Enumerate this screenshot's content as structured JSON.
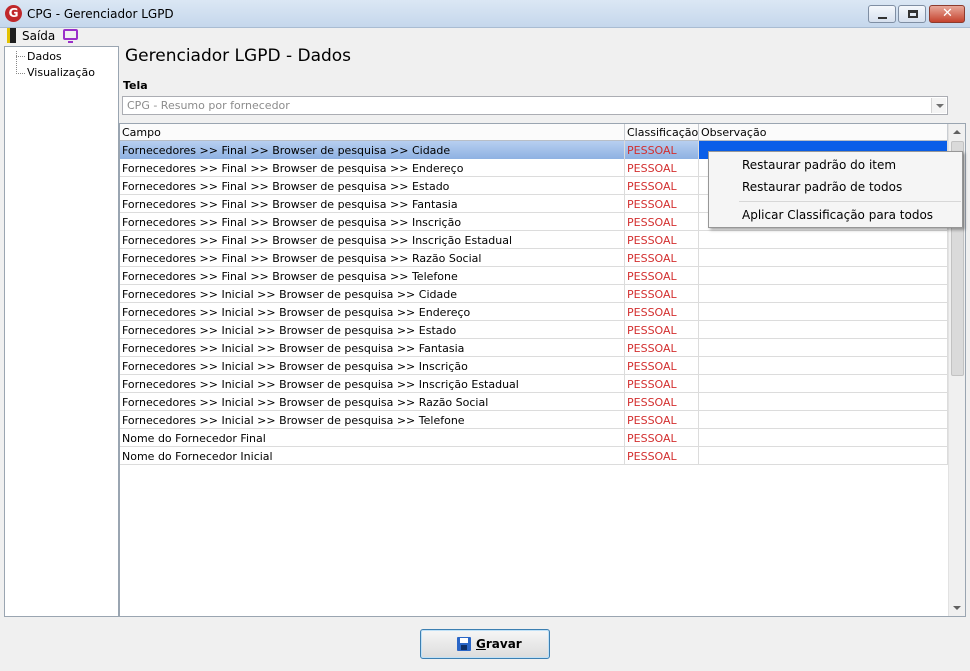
{
  "window": {
    "title": "CPG - Gerenciador LGPD",
    "logo_letter": "G"
  },
  "menu": {
    "exit_label": "Saída",
    "icons": [
      "exit-door-icon",
      "monitor-icon"
    ]
  },
  "tree": {
    "items": [
      {
        "label": "Dados"
      },
      {
        "label": "Visualização"
      }
    ]
  },
  "page": {
    "title": "Gerenciador LGPD - Dados",
    "tela_label": "Tela",
    "tela_value": "CPG - Resumo por fornecedor"
  },
  "grid": {
    "columns": [
      "Campo",
      "Classificação",
      "Observação"
    ],
    "rows": [
      {
        "campo": "Fornecedores >> Final >> Browser de pesquisa >> Cidade",
        "classificacao": "PESSOAL",
        "observacao": ""
      },
      {
        "campo": "Fornecedores >> Final >> Browser de pesquisa >> Endereço",
        "classificacao": "PESSOAL",
        "observacao": ""
      },
      {
        "campo": "Fornecedores >> Final >> Browser de pesquisa >> Estado",
        "classificacao": "PESSOAL",
        "observacao": ""
      },
      {
        "campo": "Fornecedores >> Final >> Browser de pesquisa >> Fantasia",
        "classificacao": "PESSOAL",
        "observacao": ""
      },
      {
        "campo": "Fornecedores >> Final >> Browser de pesquisa >> Inscrição",
        "classificacao": "PESSOAL",
        "observacao": ""
      },
      {
        "campo": "Fornecedores >> Final >> Browser de pesquisa >> Inscrição Estadual",
        "classificacao": "PESSOAL",
        "observacao": ""
      },
      {
        "campo": "Fornecedores >> Final >> Browser de pesquisa >> Razão Social",
        "classificacao": "PESSOAL",
        "observacao": ""
      },
      {
        "campo": "Fornecedores >> Final >> Browser de pesquisa >> Telefone",
        "classificacao": "PESSOAL",
        "observacao": ""
      },
      {
        "campo": "Fornecedores >> Inicial >> Browser de pesquisa >> Cidade",
        "classificacao": "PESSOAL",
        "observacao": ""
      },
      {
        "campo": "Fornecedores >> Inicial >> Browser de pesquisa >> Endereço",
        "classificacao": "PESSOAL",
        "observacao": ""
      },
      {
        "campo": "Fornecedores >> Inicial >> Browser de pesquisa >> Estado",
        "classificacao": "PESSOAL",
        "observacao": ""
      },
      {
        "campo": "Fornecedores >> Inicial >> Browser de pesquisa >> Fantasia",
        "classificacao": "PESSOAL",
        "observacao": ""
      },
      {
        "campo": "Fornecedores >> Inicial >> Browser de pesquisa >> Inscrição",
        "classificacao": "PESSOAL",
        "observacao": ""
      },
      {
        "campo": "Fornecedores >> Inicial >> Browser de pesquisa >> Inscrição Estadual",
        "classificacao": "PESSOAL",
        "observacao": ""
      },
      {
        "campo": "Fornecedores >> Inicial >> Browser de pesquisa >> Razão Social",
        "classificacao": "PESSOAL",
        "observacao": ""
      },
      {
        "campo": "Fornecedores >> Inicial >> Browser de pesquisa >> Telefone",
        "classificacao": "PESSOAL",
        "observacao": ""
      },
      {
        "campo": "Nome do Fornecedor Final",
        "classificacao": "PESSOAL",
        "observacao": ""
      },
      {
        "campo": "Nome do Fornecedor Inicial",
        "classificacao": "PESSOAL",
        "observacao": ""
      }
    ],
    "selected_row": 0
  },
  "context_menu": {
    "items": [
      {
        "label": "Restaurar padrão do item"
      },
      {
        "label": "Restaurar padrão de todos"
      },
      {
        "label": "Aplicar Classificação para todos"
      }
    ]
  },
  "footer": {
    "save_label": "Gravar",
    "save_accel": "G",
    "save_rest": "ravar"
  },
  "colors": {
    "classification_text": "#d32f2f",
    "selection": "#0a5ee8",
    "close_button": "#c5432e"
  }
}
